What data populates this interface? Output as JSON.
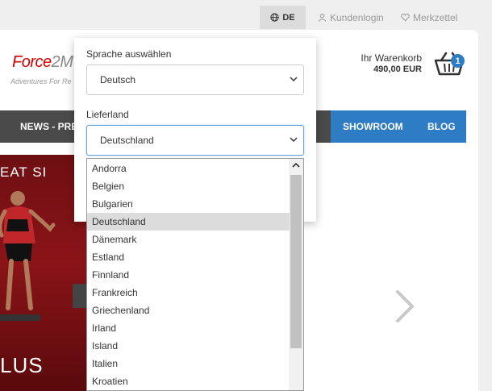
{
  "topbar": {
    "language_button": "DE",
    "login_label": "Kundenlogin",
    "wishlist_label": "Merkzettel"
  },
  "header": {
    "logo_part1": "Force",
    "logo_part2": "2M",
    "tagline": "Adventures For Re",
    "cart_label": "Ihr Warenkorb",
    "cart_total": "490,00 EUR",
    "cart_count": "1"
  },
  "nav": {
    "news_label": "NEWS - PRE",
    "showroom_label": "SHOWROOM",
    "blog_label": "BLOG"
  },
  "hero": {
    "top_text": "EAT SI",
    "bottom_text": "LUS"
  },
  "language_panel": {
    "language_label": "Sprache auswählen",
    "language_value": "Deutsch",
    "country_label": "Lieferland",
    "country_value": "Deutschland"
  },
  "country_options": [
    "Andorra",
    "Belgien",
    "Bulgarien",
    "Deutschland",
    "Dänemark",
    "Estland",
    "Finnland",
    "Frankreich",
    "Griechenland",
    "Irland",
    "Island",
    "Italien",
    "Kroatien"
  ],
  "selected_country_index": 3,
  "colors": {
    "accent_blue": "#2e7cc4",
    "nav_dark": "#4a4a4a",
    "logo_red": "#d40000"
  }
}
